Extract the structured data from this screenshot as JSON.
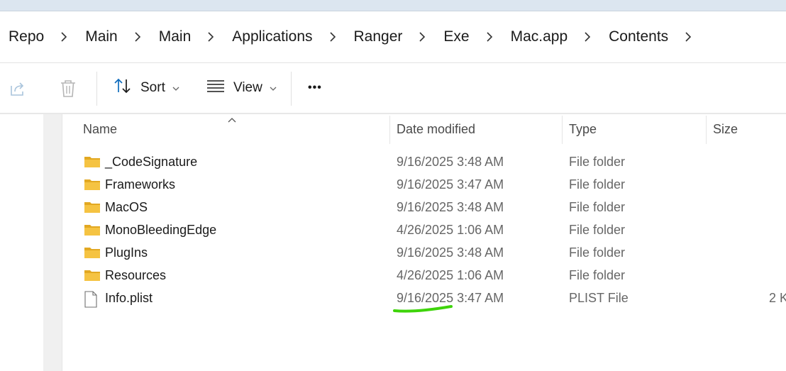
{
  "breadcrumb": {
    "items": [
      "Repo",
      "Main",
      "Main",
      "Applications",
      "Ranger",
      "Exe",
      "Mac.app",
      "Contents"
    ]
  },
  "toolbar": {
    "sort_label": "Sort",
    "view_label": "View",
    "more_label": "•••"
  },
  "columns": {
    "name": "Name",
    "date": "Date modified",
    "type": "Type",
    "size": "Size"
  },
  "files": [
    {
      "name": "_CodeSignature",
      "date": "9/16/2025 3:48 AM",
      "type": "File folder",
      "size": "",
      "icon": "folder-icon"
    },
    {
      "name": "Frameworks",
      "date": "9/16/2025 3:47 AM",
      "type": "File folder",
      "size": "",
      "icon": "folder-icon"
    },
    {
      "name": "MacOS",
      "date": "9/16/2025 3:48 AM",
      "type": "File folder",
      "size": "",
      "icon": "folder-icon"
    },
    {
      "name": "MonoBleedingEdge",
      "date": "4/26/2025 1:06 AM",
      "type": "File folder",
      "size": "",
      "icon": "folder-icon"
    },
    {
      "name": "PlugIns",
      "date": "9/16/2025 3:48 AM",
      "type": "File folder",
      "size": "",
      "icon": "folder-icon"
    },
    {
      "name": "Resources",
      "date": "4/26/2025 1:06 AM",
      "type": "File folder",
      "size": "",
      "icon": "folder-icon"
    },
    {
      "name": "Info.plist",
      "date": "9/16/2025 3:47 AM",
      "type": "PLIST File",
      "size": "2 K",
      "icon": "file-icon"
    }
  ],
  "colors": {
    "folder": "#f5c342",
    "folder_dark": "#e2a822",
    "accent": "#0f6cbd",
    "highlight": "#3ed40a"
  }
}
